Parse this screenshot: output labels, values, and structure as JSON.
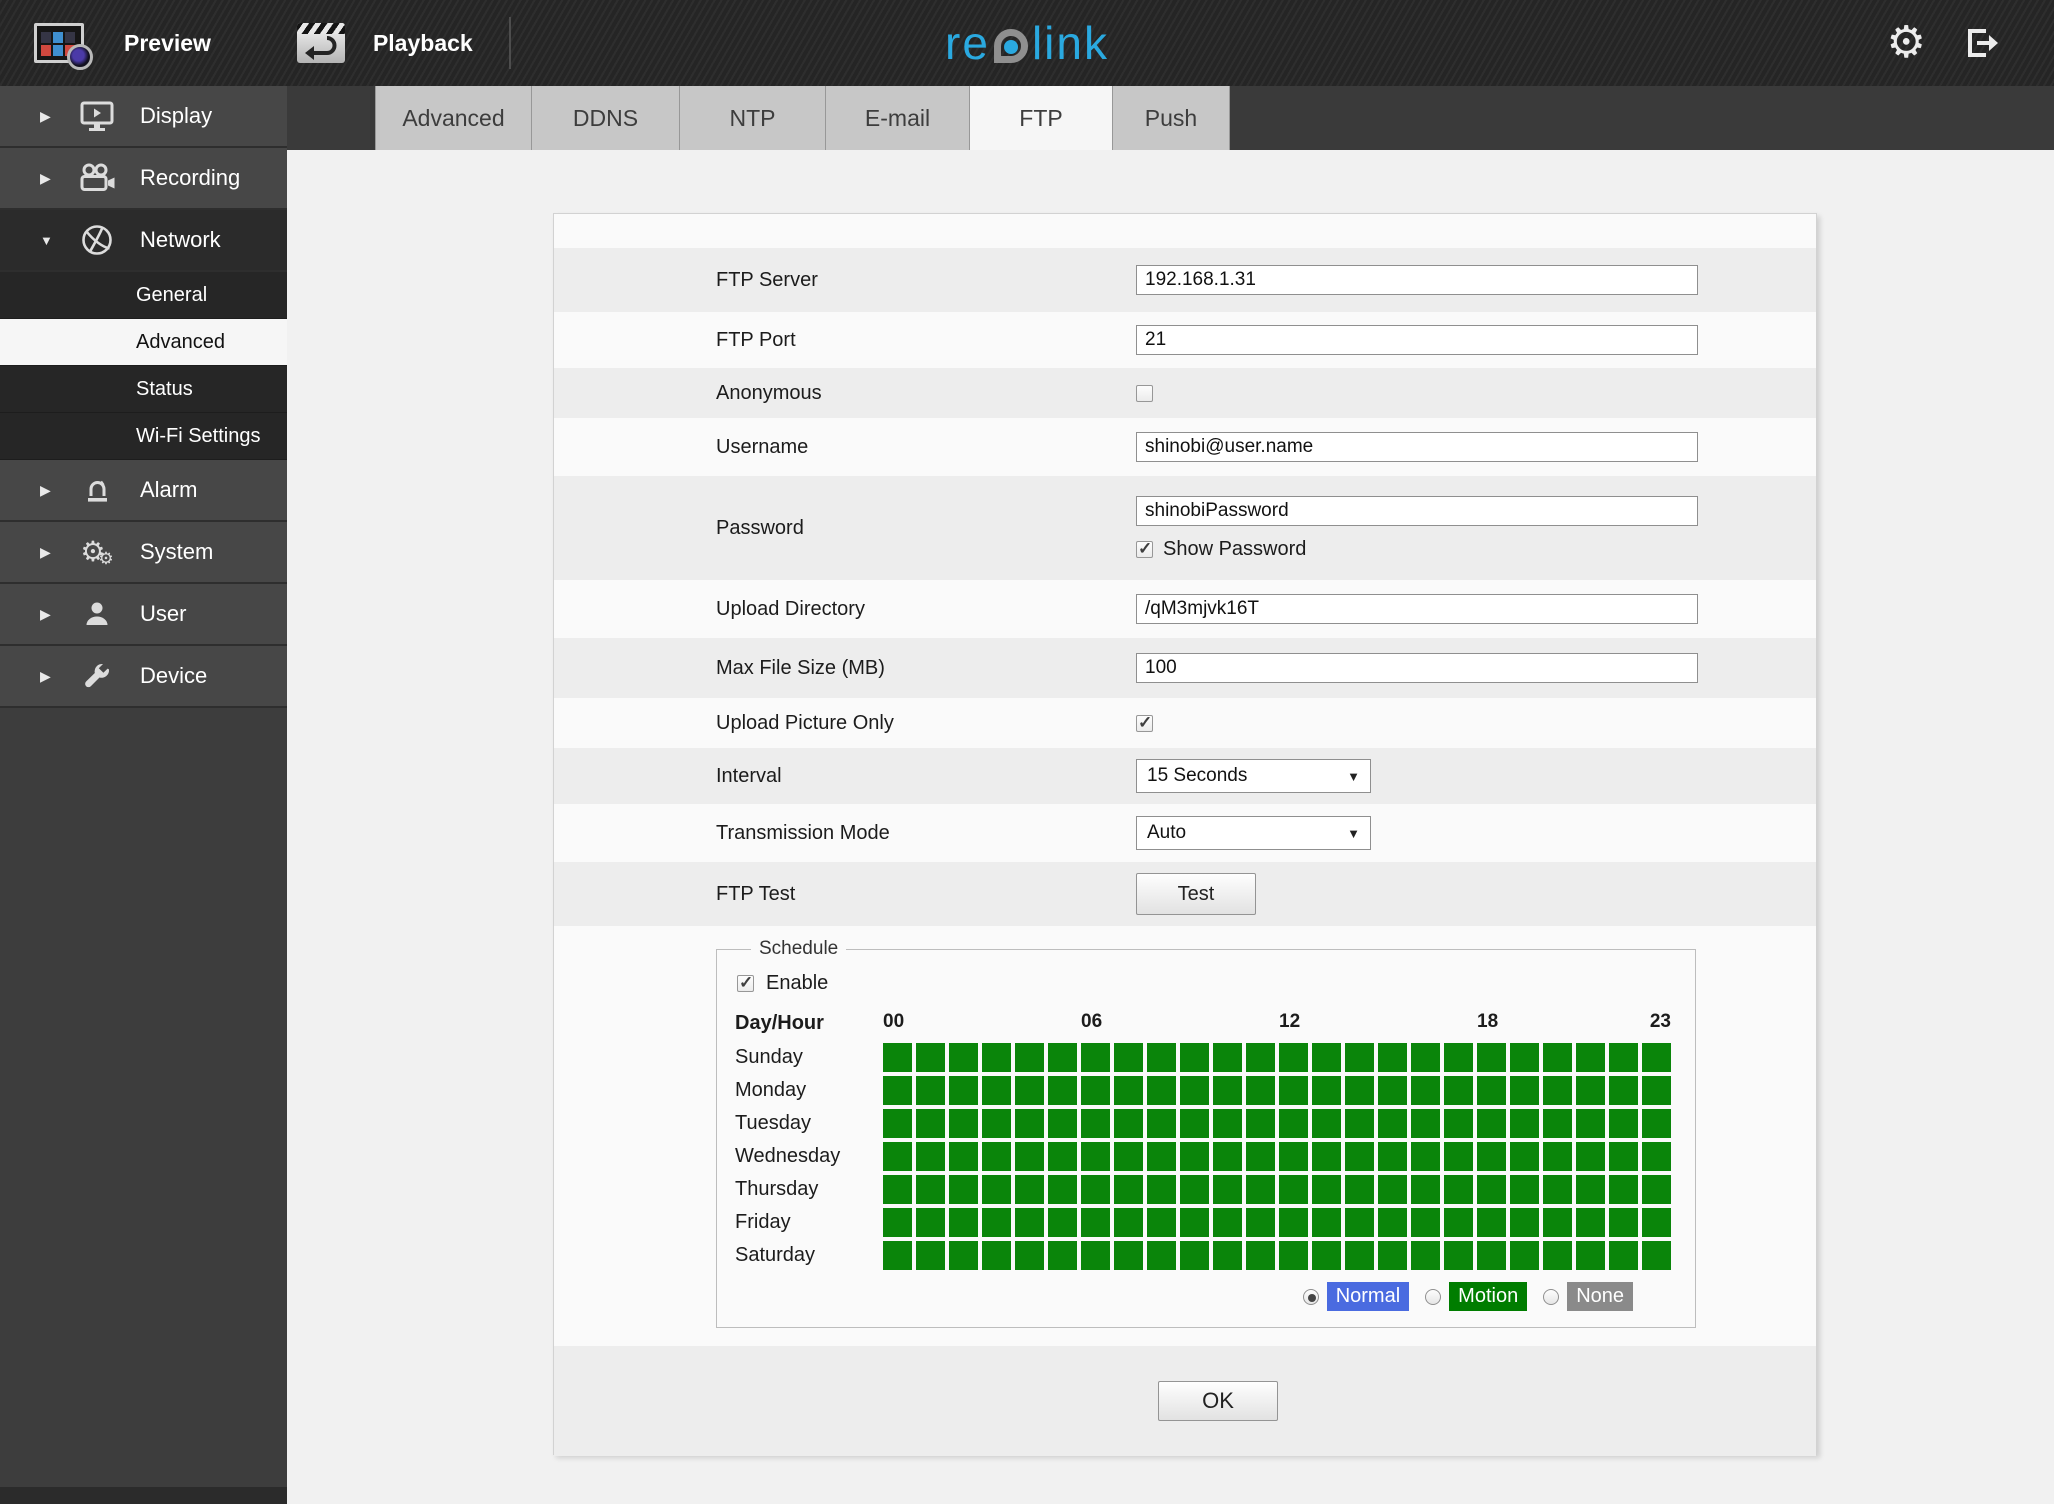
{
  "topbar": {
    "preview_label": "Preview",
    "playback_label": "Playback",
    "logo": {
      "left": "re",
      "right": "link",
      "color": "#2aa9e0"
    }
  },
  "sidebar": {
    "items": [
      {
        "label": "Display",
        "icon": "display-icon",
        "state": "collapsed"
      },
      {
        "label": "Recording",
        "icon": "recording-icon",
        "state": "collapsed"
      },
      {
        "label": "Network",
        "icon": "network-icon",
        "state": "expanded",
        "children": [
          {
            "label": "General",
            "selected": false
          },
          {
            "label": "Advanced",
            "selected": true
          },
          {
            "label": "Status",
            "selected": false
          },
          {
            "label": "Wi-Fi Settings",
            "selected": false
          }
        ]
      },
      {
        "label": "Alarm",
        "icon": "alarm-icon",
        "state": "collapsed"
      },
      {
        "label": "System",
        "icon": "system-icon",
        "state": "collapsed"
      },
      {
        "label": "User",
        "icon": "user-icon",
        "state": "collapsed"
      },
      {
        "label": "Device",
        "icon": "device-icon",
        "state": "collapsed"
      }
    ]
  },
  "tabs": {
    "active": "FTP",
    "items": [
      {
        "label": "Advanced"
      },
      {
        "label": "DDNS"
      },
      {
        "label": "NTP"
      },
      {
        "label": "E-mail"
      },
      {
        "label": "FTP"
      },
      {
        "label": "Push"
      }
    ]
  },
  "form": {
    "ftp_server": {
      "label": "FTP Server",
      "value": "192.168.1.31"
    },
    "ftp_port": {
      "label": "FTP Port",
      "value": "21"
    },
    "anonymous": {
      "label": "Anonymous",
      "checked": false
    },
    "username": {
      "label": "Username",
      "value": "shinobi@user.name"
    },
    "password": {
      "label": "Password",
      "value": "shinobiPassword",
      "show_password": {
        "label": "Show Password",
        "checked": true
      }
    },
    "upload_dir": {
      "label": "Upload Directory",
      "value": "/qM3mjvk16T"
    },
    "max_size": {
      "label": "Max File Size (MB)",
      "value": "100"
    },
    "pic_only": {
      "label": "Upload Picture Only",
      "checked": true
    },
    "interval": {
      "label": "Interval",
      "value": "15 Seconds"
    },
    "trans_mode": {
      "label": "Transmission Mode",
      "value": "Auto"
    },
    "ftp_test": {
      "label": "FTP Test",
      "button_label": "Test"
    },
    "ok_label": "OK"
  },
  "schedule": {
    "legend": "Schedule",
    "enable_label": "Enable",
    "enabled": true,
    "day_hour_label": "Day/Hour",
    "hour_labels": [
      {
        "text": "00",
        "col": 0
      },
      {
        "text": "06",
        "col": 6
      },
      {
        "text": "12",
        "col": 12
      },
      {
        "text": "18",
        "col": 18
      },
      {
        "text": "23",
        "col": 23,
        "align": "right"
      }
    ],
    "days": [
      "Sunday",
      "Monday",
      "Tuesday",
      "Wednesday",
      "Thursday",
      "Friday",
      "Saturday"
    ],
    "columns": 24,
    "all_cells_selected": true,
    "cell_color": "#0a850a",
    "modes": [
      {
        "label": "Normal",
        "color": "#4a6be0",
        "selected": true
      },
      {
        "label": "Motion",
        "color": "#007d00",
        "selected": false
      },
      {
        "label": "None",
        "color": "#8a8a8a",
        "selected": false
      }
    ]
  }
}
